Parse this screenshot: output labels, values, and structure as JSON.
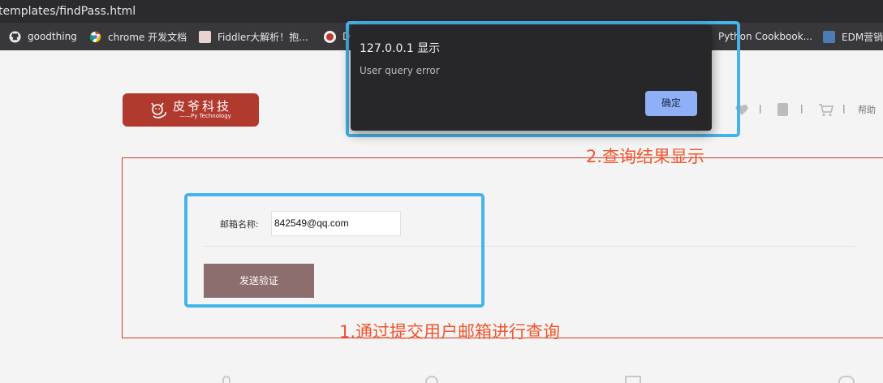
{
  "browser": {
    "url": "templates/findPass.html",
    "bookmarks": [
      {
        "label": "goodthing",
        "icon": "github-icon"
      },
      {
        "label": "chrome 开发文档",
        "icon": "chrome-icon"
      },
      {
        "label": "Fiddler大解析！抱...",
        "icon": "bookmark-favicon-icon"
      },
      {
        "label": "D",
        "icon": "bookmark-favicon-icon"
      },
      {
        "label": "Python Cookbook...",
        "icon": "document-icon"
      },
      {
        "label": "EDM营销",
        "icon": "bookmark-favicon-icon"
      }
    ]
  },
  "header": {
    "logo_name": "皮爷科技",
    "logo_sub": "——Py Technology",
    "nav_separator": "|",
    "nav_help": "帮助"
  },
  "form": {
    "email_label": "邮箱名称:",
    "email_value": "842549@qq.com",
    "submit_label": "发送验证"
  },
  "annotations": {
    "step1": "1.通过提交用户邮箱进行查询",
    "step2": "2.查询结果显示"
  },
  "dialog": {
    "title": "127.0.0.1 显示",
    "message": "User query error",
    "ok_label": "确定"
  },
  "colors": {
    "brand_red": "#b13a2f",
    "highlight_blue": "#45b3ec",
    "annotation_orange": "#f0562f",
    "button_mauve": "#8c6e6e",
    "dialog_ok_blue": "#8fb0f7"
  }
}
